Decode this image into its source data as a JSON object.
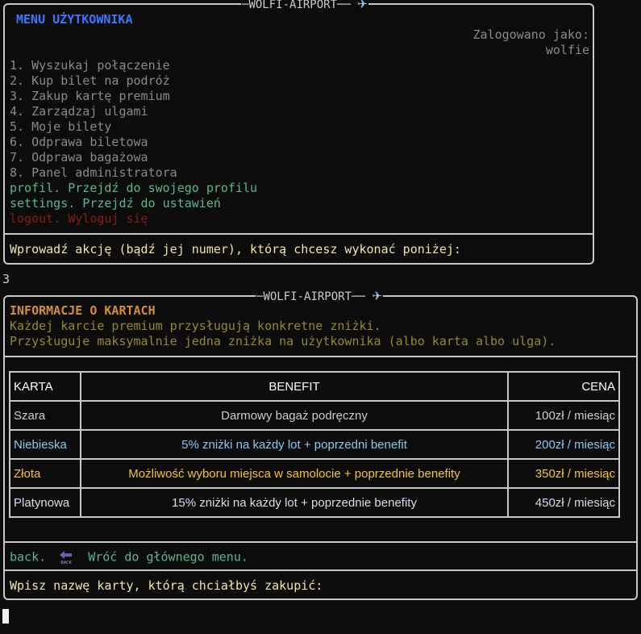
{
  "app_title": "WOLFI-AIRPORT",
  "user_menu": {
    "heading": "MENU UŻYTKOWNIKA",
    "logged_in_label": "Zalogowano jako:",
    "username": "wolfie",
    "items": [
      "1. Wyszukaj połączenie",
      "2. Kup bilet na podróż",
      "3. Zakup kartę premium",
      "4. Zarządzaj ulgami",
      "5. Moje bilety",
      "6. Odprawa biletowa",
      "7. Odprawa bagażowa",
      "8. Panel administratora"
    ],
    "profile_item": "profil. Przejdź do swojego profilu",
    "settings_item": "settings. Przejdź do ustawień",
    "logout_item": "logout. Wyloguj się",
    "prompt": "Wprowadź akcję (bądź jej numer), którą chcesz wykonać poniżej:"
  },
  "user_input": "3",
  "cards_screen": {
    "heading": "INFORMACJE O KARTACH",
    "info_line_1": "Każdej karcie premium przysługują konkretne zniżki.",
    "info_line_2": "Przysługuje maksymalnie jedna zniżka na użytkownika (albo karta albo ulga).",
    "table": {
      "headers": [
        "KARTA",
        "BENEFIT",
        "CENA"
      ],
      "rows": [
        {
          "karta": "Szara",
          "benefit": "Darmowy bagaż podręczny",
          "cena": "100zł / miesiąc"
        },
        {
          "karta": "Niebieska",
          "benefit": "5% zniżki na każdy lot + poprzedni benefit",
          "cena": "200zł / miesiąc"
        },
        {
          "karta": "Złota",
          "benefit": "Możliwość wyboru miejsca w samolocie + poprzednie benefity",
          "cena": "350zł / miesiąc"
        },
        {
          "karta": "Platynowa",
          "benefit": "15% zniżki na każdy lot + poprzednie benefity",
          "cena": "450zł / miesiąc"
        }
      ]
    },
    "back_key": "back.",
    "back_icon_text": "BACK",
    "back_label": "Wróć do głównego menu.",
    "prompt": "Wpisz nazwę karty, którą chciałbyś zakupić:"
  },
  "colors": {
    "menu_heading": "#3b78ff",
    "menu_item": "#8a8a8a",
    "profile_settings": "#58b98a",
    "logout": "#8b1a1a",
    "prompt": "#f2e6a6",
    "info_heading": "#d7902b",
    "info_text": "#938a2d",
    "row_szara": "#cccccc",
    "row_niebieska": "#8cc8ef",
    "row_zlota": "#f2c531",
    "row_platynowa": "#dcdcf0"
  },
  "icons": {
    "title_icon": "airplane-icon",
    "back_icon": "back-arrow-icon"
  }
}
